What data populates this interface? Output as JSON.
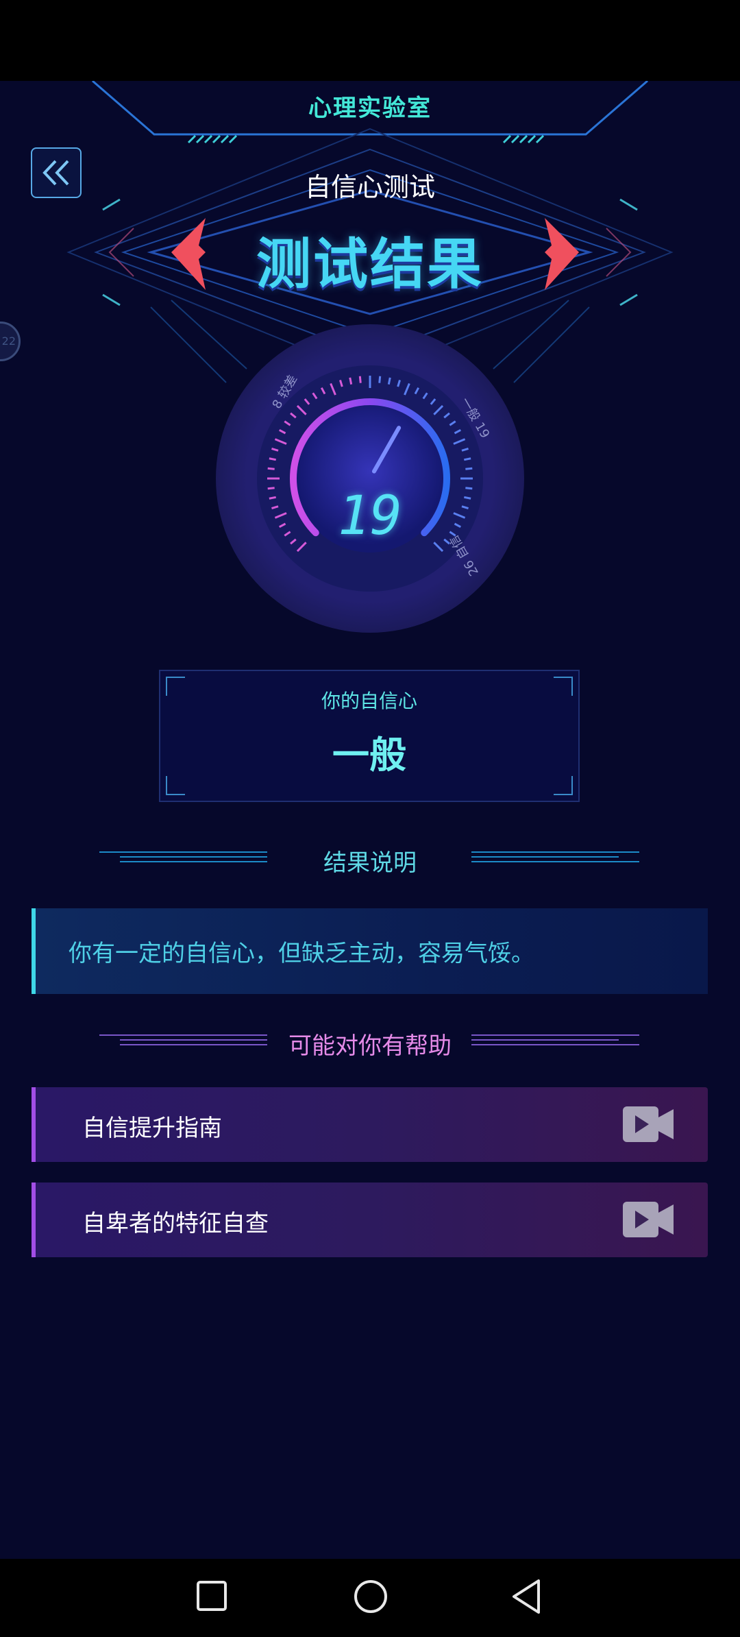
{
  "header": {
    "lab_title": "心理实验室",
    "subtitle": "自信心测试",
    "title": "测试结果"
  },
  "gauge": {
    "value": "19",
    "min_label": "8",
    "min_word": "较差",
    "mid_label": "19",
    "mid_word": "一般",
    "max_label": "26",
    "max_word": "自信",
    "level_fraction": 0.61
  },
  "result": {
    "label": "你的自信心",
    "value": "一般"
  },
  "explanation": {
    "section_title": "结果说明",
    "text": "你有一定的自信心，但缺乏主动，容易气馁。"
  },
  "help": {
    "section_title": "可能对你有帮助",
    "items": [
      {
        "label": "自信提升指南",
        "icon": "video-camera-icon"
      },
      {
        "label": "自卑者的特征自查",
        "icon": "video-camera-icon"
      }
    ]
  },
  "side_bubble": {
    "text": "22"
  },
  "colors": {
    "background": "#06082b",
    "accent_cyan": "#46d7f4",
    "accent_purple": "#a24ee6",
    "arrow_red": "#f0505e"
  }
}
